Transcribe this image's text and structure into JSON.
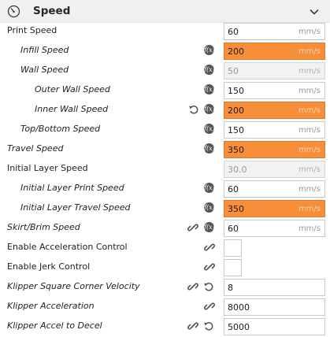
{
  "section": {
    "title": "Speed",
    "icon": "speedometer-icon",
    "collapse_icon": "chevron-down-icon"
  },
  "colors": {
    "warning": "#f68e3a",
    "disabled_bg": "#f2f2f2",
    "header_bg": "#f0f0f0"
  },
  "settings": [
    {
      "label": "Print Speed",
      "value": "60",
      "unit": "mm/s"
    },
    {
      "label": "Infill Speed",
      "value": "200",
      "unit": "mm/s",
      "state": "warning"
    },
    {
      "label": "Wall Speed",
      "value": "50",
      "unit": "mm/s",
      "state": "disabled"
    },
    {
      "label": "Outer Wall Speed",
      "value": "150",
      "unit": "mm/s"
    },
    {
      "label": "Inner Wall Speed",
      "value": "200",
      "unit": "mm/s",
      "state": "warning"
    },
    {
      "label": "Top/Bottom Speed",
      "value": "150",
      "unit": "mm/s"
    },
    {
      "label": "Travel Speed",
      "value": "350",
      "unit": "mm/s",
      "state": "warning"
    },
    {
      "label": "Initial Layer Speed",
      "value": "30.0",
      "unit": "mm/s",
      "state": "disabled"
    },
    {
      "label": "Initial Layer Print Speed",
      "value": "60",
      "unit": "mm/s"
    },
    {
      "label": "Initial Layer Travel Speed",
      "value": "350",
      "unit": "mm/s",
      "state": "warning"
    },
    {
      "label": "Skirt/Brim Speed",
      "value": "60",
      "unit": "mm/s"
    },
    {
      "label": "Enable Acceleration Control",
      "checked": false
    },
    {
      "label": "Enable Jerk Control",
      "checked": false
    },
    {
      "label": "Klipper Square Corner Velocity",
      "value": "8"
    },
    {
      "label": "Klipper Acceleration",
      "value": "8000"
    },
    {
      "label": "Klipper Accel to Decel",
      "value": "5000"
    }
  ]
}
